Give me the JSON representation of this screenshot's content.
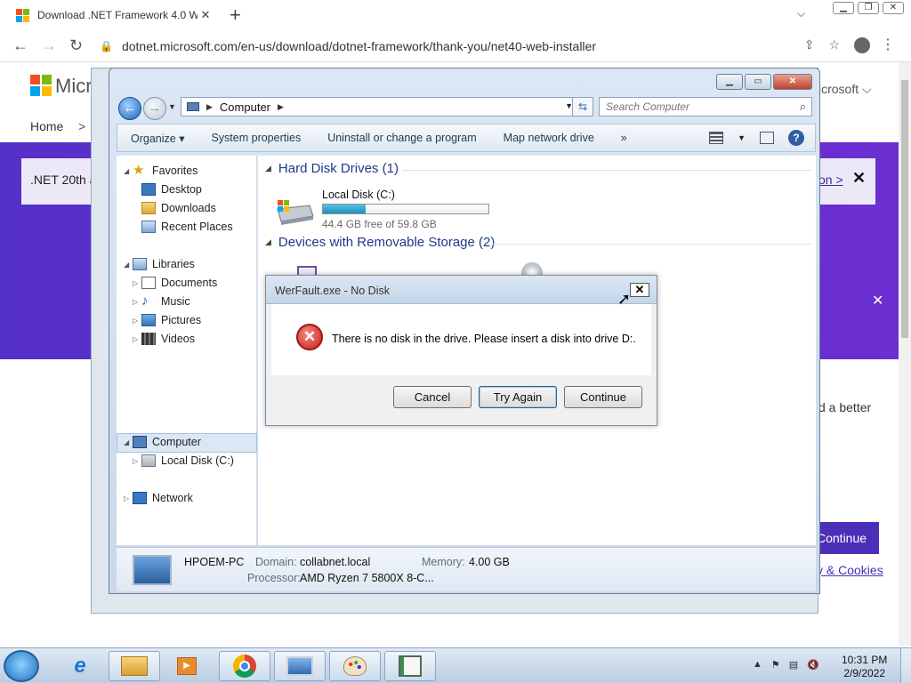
{
  "browser": {
    "tab_title": "Download .NET Framework 4.0 W",
    "tab_close": "✕",
    "new_tab": "+",
    "url": "dotnet.microsoft.com/en-us/download/dotnet-framework/thank-you/net40-web-installer"
  },
  "webpage": {
    "logo_text": "Micr",
    "header_right": "icrosoft ⌵",
    "breadcrumb_home": "Home",
    "breadcrumb_sep": ">",
    "banner_left": ".NET 20th a",
    "banner_right": "on >",
    "banner_close": "✕",
    "purple_close": "✕",
    "side_text": "d a better",
    "continue_label": "Continue",
    "cookies_link": "y & Cookies"
  },
  "explorer": {
    "address_location": "Computer",
    "search_placeholder": "Search Computer",
    "command_bar": [
      "Organize ▾",
      "System properties",
      "Uninstall or change a program",
      "Map network drive",
      "»"
    ],
    "nav_pane": {
      "favorites": "Favorites",
      "desktop": "Desktop",
      "downloads": "Downloads",
      "recent_places": "Recent Places",
      "libraries": "Libraries",
      "documents": "Documents",
      "music": "Music",
      "pictures": "Pictures",
      "videos": "Videos",
      "computer": "Computer",
      "local_disk": "Local Disk (C:)",
      "network": "Network"
    },
    "hard_disk_header": "Hard Disk Drives (1)",
    "removable_header": "Devices with Removable Storage (2)",
    "disk": {
      "name": "Local Disk (C:)",
      "free_text": "44.4 GB free of 59.8 GB",
      "used_fraction": 0.26
    },
    "details": {
      "pc_name": "HPOEM-PC",
      "domain_label": "Domain:",
      "domain_value": "collabnet.local",
      "memory_label": "Memory:",
      "memory_value": "4.00 GB",
      "processor_label": "Processor:",
      "processor_value": "AMD Ryzen 7 5800X 8-C..."
    }
  },
  "dialog": {
    "title": "WerFault.exe - No Disk",
    "message": "There is no disk in the drive. Please insert a disk into drive D:.",
    "close": "✕",
    "buttons": {
      "cancel": "Cancel",
      "try_again": "Try Again",
      "continue": "Continue"
    }
  },
  "taskbar": {
    "time": "10:31 PM",
    "date": "2/9/2022"
  }
}
